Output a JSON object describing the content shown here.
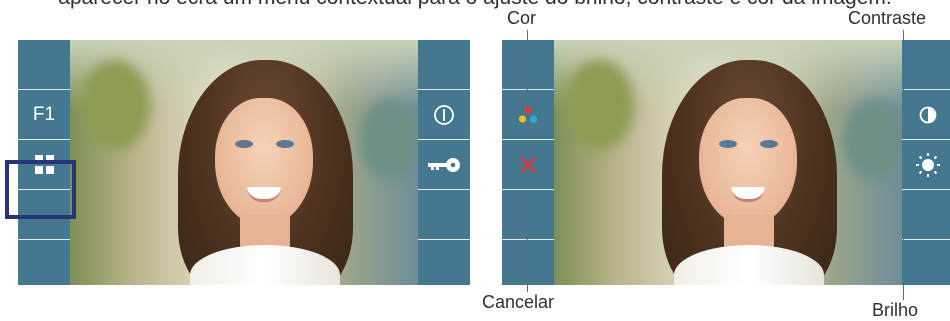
{
  "caption_text": "aparecer no ecrã um menu contextual para o ajuste do brilho, contraste e cor da imagem.",
  "left_screen": {
    "left_buttons": {
      "f1_label": "F1",
      "menu_icon": "grid-menu-icon"
    },
    "right_buttons": {
      "power_icon": "power-icon",
      "key_icon": "key-icon"
    }
  },
  "right_screen": {
    "left_buttons": {
      "color_icon": "color-dots-icon",
      "cancel_icon": "cancel-x-icon"
    },
    "right_buttons": {
      "contrast_icon": "contrast-icon",
      "brightness_icon": "brightness-icon"
    }
  },
  "annotations": {
    "cor": "Cor",
    "contraste": "Contraste",
    "cancelar": "Cancelar",
    "brilho": "Brilho"
  },
  "colors": {
    "panel": "#44788f",
    "highlight_border": "#28347a",
    "pointer": "#d23c3c",
    "cancel_x": "#e8323a"
  }
}
